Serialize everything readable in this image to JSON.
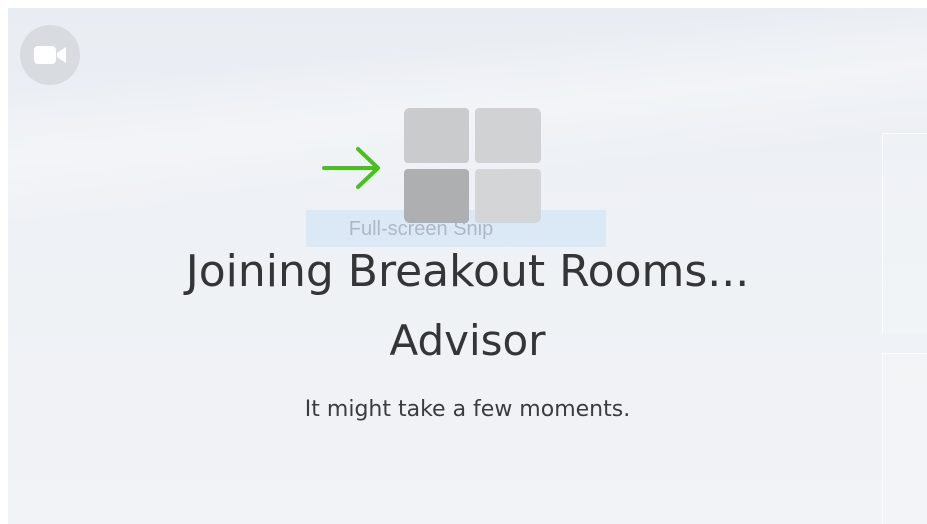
{
  "status": {
    "title": "Joining Breakout Rooms...",
    "room_name": "Advisor",
    "message": "It might take a few moments."
  },
  "snip_overlay": {
    "label": "Full-screen Snip",
    "icon": "full-screen-snip-icon",
    "arrow_icon": "arrow-right-icon",
    "arrow_color": "#46c21a"
  },
  "controls": {
    "camera_icon": "video-camera-icon"
  },
  "colors": {
    "background": "#eceff3",
    "text": "#333536",
    "camera_button_bg": "#d8dbe0"
  }
}
